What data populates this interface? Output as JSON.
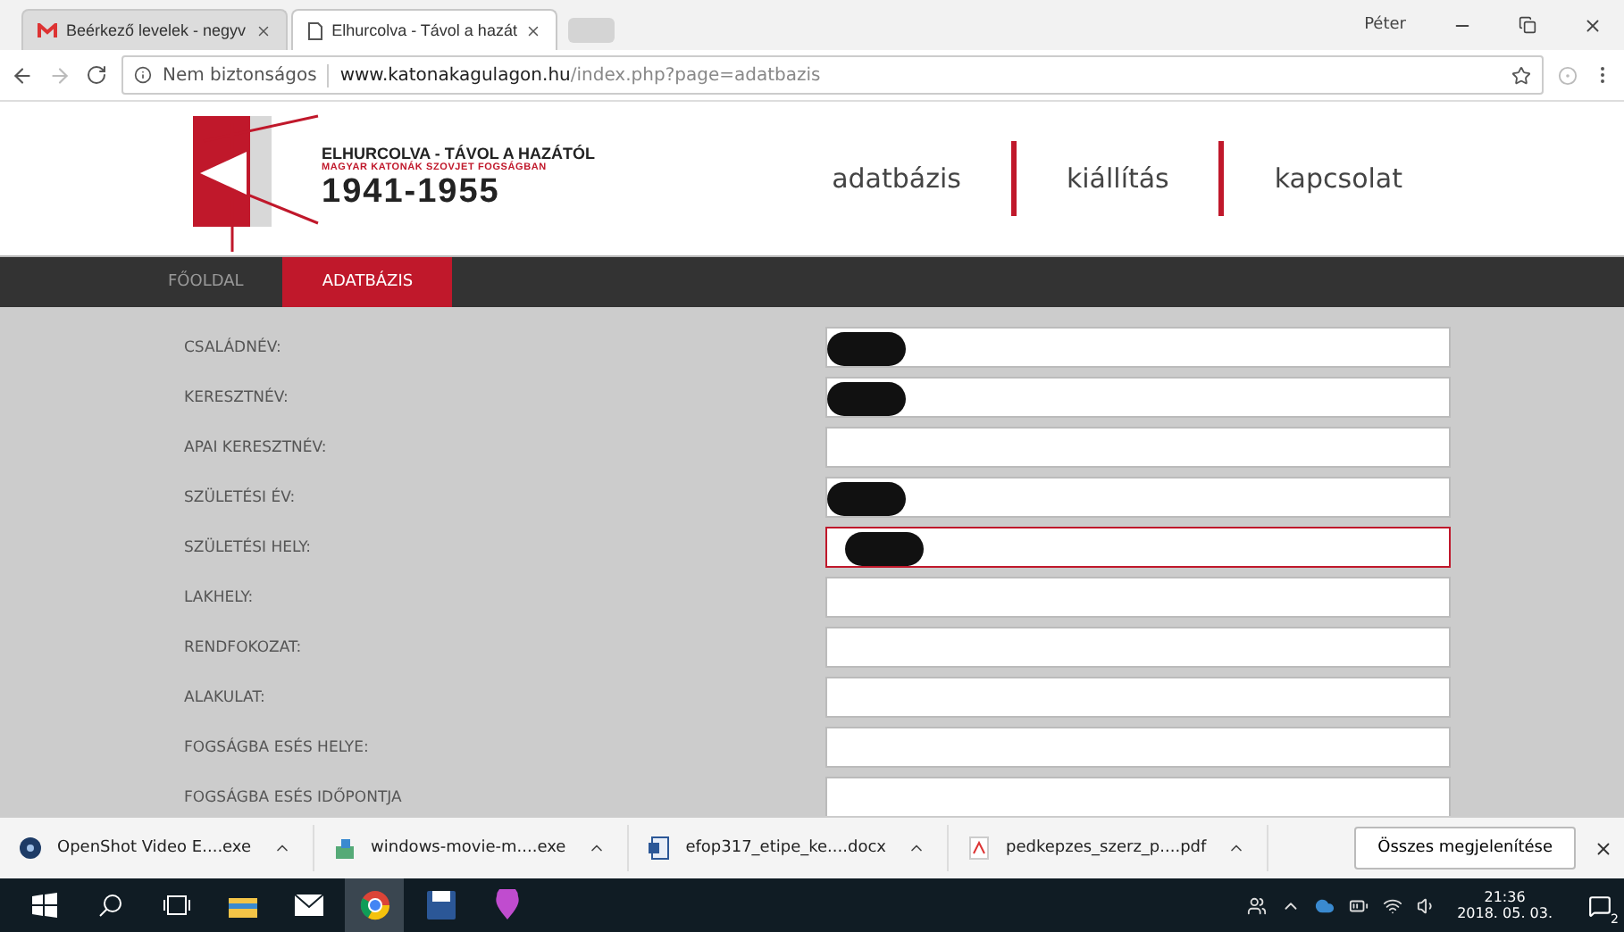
{
  "browser": {
    "tabs": [
      {
        "title": "Beérkező levelek - negyv",
        "kind": "mail",
        "selected": false
      },
      {
        "title": "Elhurcolva - Távol a hazát",
        "kind": "page",
        "selected": true
      }
    ],
    "user": "Péter",
    "security": "Nem biztonságos",
    "url_host": "www.katonakagulagon.hu",
    "url_path": "/index.php?page=adatbazis"
  },
  "header": {
    "logo_title": "ELHURCOLVA - TÁVOL A HAZÁTÓL",
    "logo_subtitle": "MAGYAR KATONÁK SZOVJET FOGSÁGBAN",
    "logo_years": "1941-1955",
    "links": [
      "adatbázis",
      "kiállítás",
      "kapcsolat"
    ]
  },
  "nav": [
    {
      "label": "FŐOLDAL",
      "selected": false
    },
    {
      "label": "ADATBÁZIS",
      "selected": true
    }
  ],
  "form": [
    {
      "label": "CSALÁDNÉV:",
      "redacted": true,
      "focused": false
    },
    {
      "label": "KERESZTNÉV:",
      "redacted": true,
      "focused": false
    },
    {
      "label": "APAI KERESZTNÉV:",
      "redacted": false,
      "focused": false
    },
    {
      "label": "SZÜLETÉSI ÉV:",
      "redacted": true,
      "focused": false
    },
    {
      "label": "SZÜLETÉSI HELY:",
      "redacted": true,
      "focused": true
    },
    {
      "label": "LAKHELY:",
      "redacted": false,
      "focused": false
    },
    {
      "label": "RENDFOKOZAT:",
      "redacted": false,
      "focused": false
    },
    {
      "label": "ALAKULAT:",
      "redacted": false,
      "focused": false
    },
    {
      "label": "FOGSÁGBA ESÉS HELYE:",
      "redacted": false,
      "focused": false
    },
    {
      "label": "FOGSÁGBA ESÉS IDŐPONTJA",
      "redacted": false,
      "focused": false
    }
  ],
  "downloads": {
    "items": [
      {
        "name": "OpenShot Video E....exe",
        "kind": "disc"
      },
      {
        "name": "windows-movie-m....exe",
        "kind": "installer"
      },
      {
        "name": "efop317_etipe_ke....docx",
        "kind": "word"
      },
      {
        "name": "pedkepzes_szerz_p....pdf",
        "kind": "pdf"
      }
    ],
    "show_all": "Összes megjelenítése"
  },
  "taskbar": {
    "time": "21:36",
    "date": "2018. 05. 03.",
    "notifications": "2"
  }
}
